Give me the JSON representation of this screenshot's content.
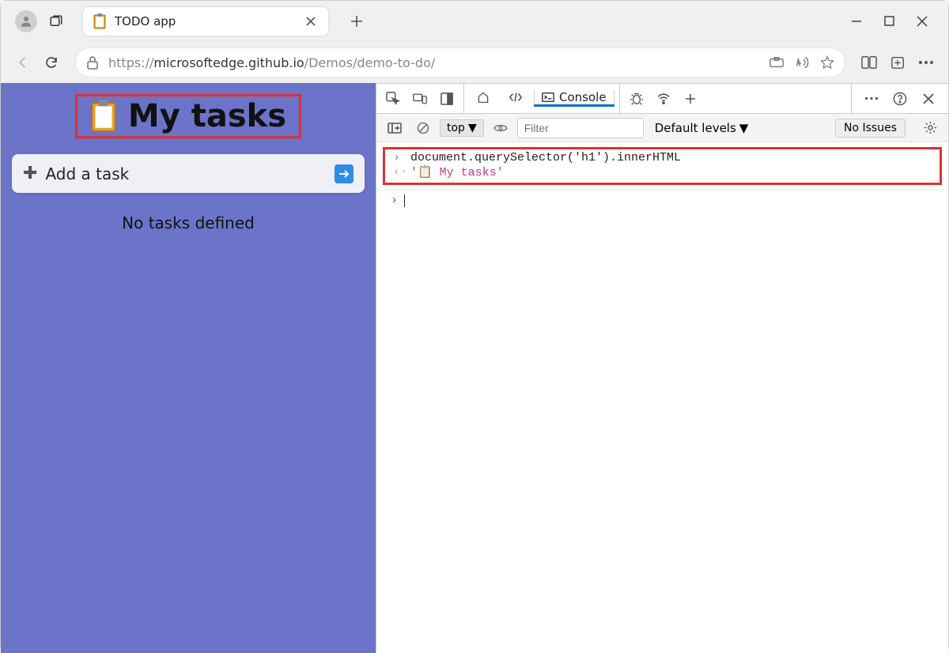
{
  "browser": {
    "tab_title": "TODO app",
    "url_prefix": "https://",
    "url_host": "microsoftedge.github.io",
    "url_path": "/Demos/demo-to-do/"
  },
  "page": {
    "heading": "My tasks",
    "add_task_placeholder": "Add a task",
    "empty_message": "No tasks defined"
  },
  "devtools": {
    "tab_console": "Console",
    "context": "top",
    "filter_placeholder": "Filter",
    "levels_label": "Default levels",
    "issues_label": "No Issues",
    "input_line": "document.querySelector('h1').innerHTML",
    "output_line": "'📋 My tasks'"
  }
}
